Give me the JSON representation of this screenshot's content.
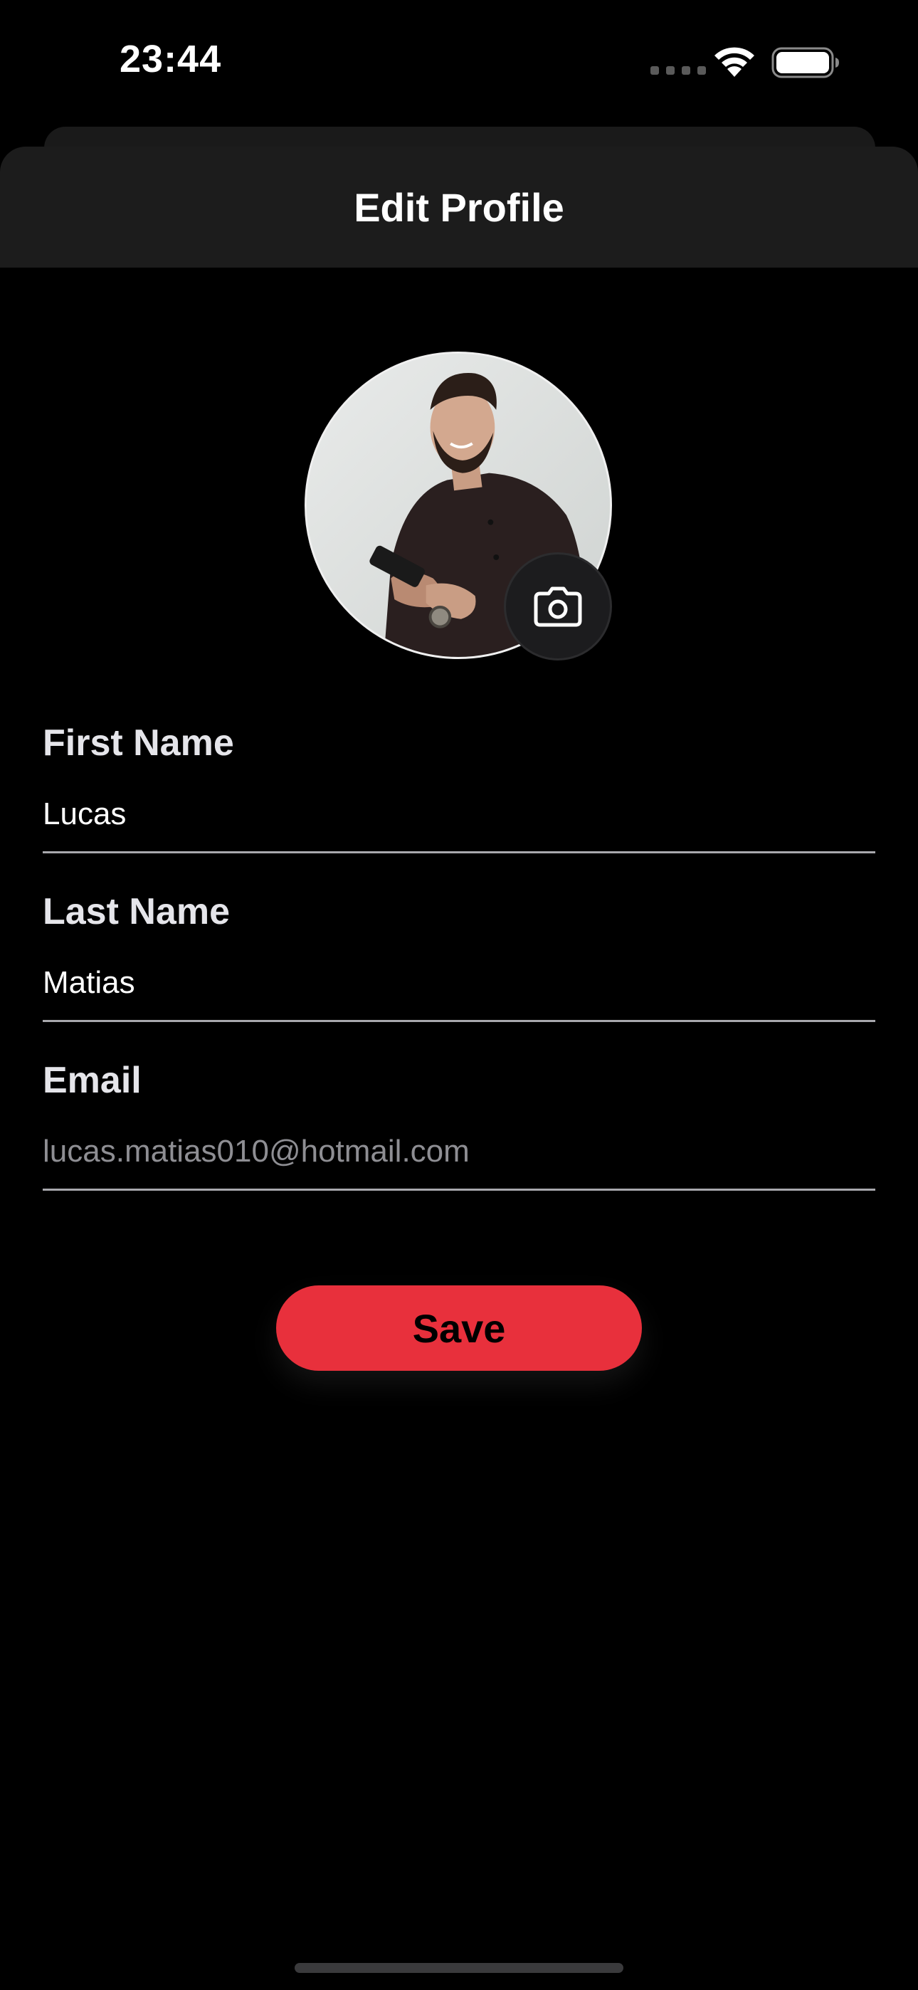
{
  "status_bar": {
    "time": "23:44",
    "icons": [
      "cellular-signal-icon",
      "wifi-icon",
      "battery-icon"
    ]
  },
  "sheet": {
    "title": "Edit Profile"
  },
  "avatar": {
    "alt": "Profile photo",
    "camera_icon": "camera-icon"
  },
  "form": {
    "first_name": {
      "label": "First Name",
      "value": "Lucas"
    },
    "last_name": {
      "label": "Last Name",
      "value": "Matias"
    },
    "email": {
      "label": "Email",
      "value": "lucas.matias010@hotmail.com"
    }
  },
  "actions": {
    "save_label": "Save"
  },
  "colors": {
    "background": "#000000",
    "header_background": "#1c1c1c",
    "accent": "#e8303c",
    "label": "#e5e5ea",
    "muted_text": "#8e8e93",
    "underline": "#a8a8ad"
  }
}
